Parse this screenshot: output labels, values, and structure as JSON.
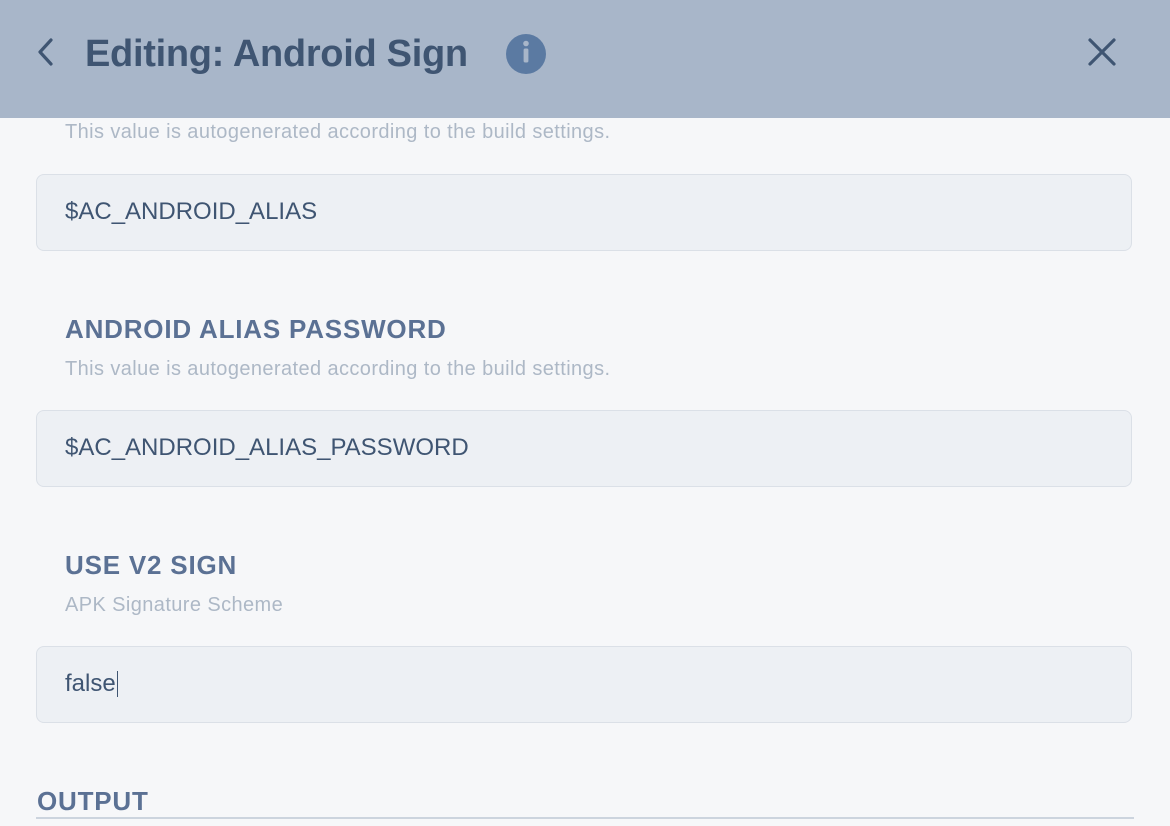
{
  "header": {
    "title": "Editing: Android Sign",
    "info_icon_glyph": "i",
    "background": "#a8b6c9"
  },
  "fields": [
    {
      "hint": "This value is autogenerated according to the build settings.",
      "value": "$AC_ANDROID_ALIAS"
    },
    {
      "label": "ANDROID ALIAS PASSWORD",
      "hint": "This value is autogenerated according to the build settings.",
      "value": "$AC_ANDROID_ALIAS_PASSWORD"
    },
    {
      "label": "USE V2 SIGN",
      "hint": "APK Signature Scheme",
      "value": "false"
    }
  ],
  "output_section": {
    "title": "OUTPUT"
  },
  "icons": {
    "back": "chevron-left-icon",
    "info": "info-icon",
    "close": "close-icon"
  },
  "colors": {
    "accent": "#5b7aa2",
    "text_dark": "#3f5572",
    "label": "#5b7194",
    "hint": "#adb8c6"
  }
}
